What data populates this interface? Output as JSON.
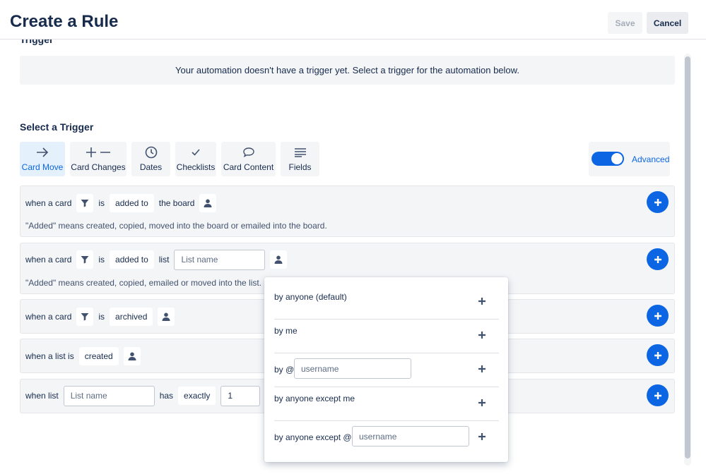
{
  "header": {
    "title": "Create a Rule",
    "save_label": "Save",
    "cancel_label": "Cancel"
  },
  "trigger_section": {
    "heading": "Trigger",
    "notice": "Your automation doesn't have a trigger yet. Select a trigger for the automation below."
  },
  "select_trigger": {
    "title": "Select a Trigger",
    "tabs": [
      {
        "label": "Card Move",
        "icon": "arrow-right-icon",
        "active": true
      },
      {
        "label": "Card Changes",
        "icon": "plus-minus-icon",
        "active": false
      },
      {
        "label": "Dates",
        "icon": "clock-icon",
        "active": false
      },
      {
        "label": "Checklists",
        "icon": "checkmark-icon",
        "active": false
      },
      {
        "label": "Card Content",
        "icon": "comment-icon",
        "active": false
      },
      {
        "label": "Fields",
        "icon": "lines-icon",
        "active": false
      }
    ],
    "advanced_label": "Advanced",
    "advanced_on": true
  },
  "rows": [
    {
      "when": "when a card",
      "is": "is",
      "action": "added to",
      "target": "the board",
      "description": "\"Added\" means created, copied, moved into the board or emailed into the board."
    },
    {
      "when": "when a card",
      "is": "is",
      "action": "added to",
      "target": "list",
      "list_placeholder": "List name",
      "description": "\"Added\" means created, copied, emailed or moved into the list."
    },
    {
      "when": "when a card",
      "is": "is",
      "action": "archived"
    },
    {
      "when": "when a list is",
      "action": "created"
    },
    {
      "when": "when list",
      "list_placeholder": "List name",
      "has": "has",
      "operator": "exactly",
      "count": "1"
    }
  ],
  "popover": {
    "items": [
      {
        "label": "by anyone (default)"
      },
      {
        "label": "by me"
      },
      {
        "label": "by @",
        "placeholder": "username"
      },
      {
        "label": "by anyone except me"
      },
      {
        "label": "by anyone except @",
        "placeholder": "username"
      }
    ]
  },
  "colors": {
    "accent": "#0c66e4",
    "row_bg": "#f4f5f7",
    "text": "#172b4d"
  }
}
